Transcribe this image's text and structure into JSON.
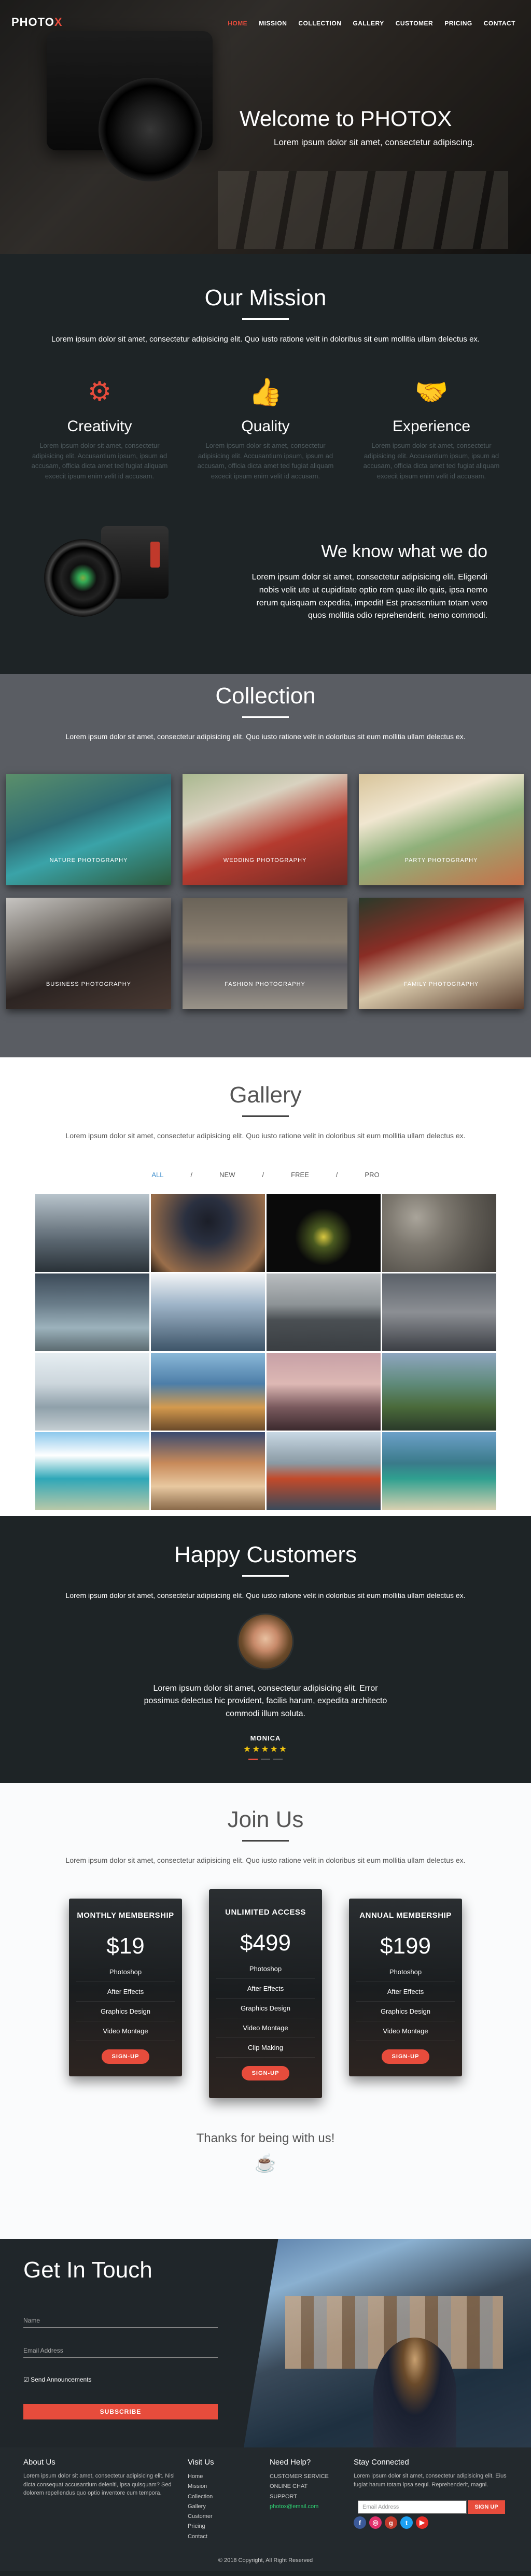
{
  "brand": {
    "logo_text": "PHOTO",
    "logo_x": "X",
    "accent": "#e74c3c"
  },
  "nav": [
    "HOME",
    "MISSION",
    "COLLECTION",
    "GALLERY",
    "CUSTOMER",
    "PRICING",
    "CONTACT"
  ],
  "hero": {
    "title": "Welcome to PHOTO",
    "title_x": "X",
    "subtitle": "Lorem ipsum dolor sit amet, consectetur adipiscing."
  },
  "mission": {
    "title": "Our Mission",
    "lead": "Lorem ipsum dolor sit amet, consectetur adipisicing elit. Quo iusto ratione velit in doloribus sit eum mollitia ullam delectus ex.",
    "features": [
      {
        "icon": "gears-icon",
        "title": "Creativity",
        "text": "Lorem ipsum dolor sit amet, consectetur adipisicing elit. Accusantium ipsum, ipsum ad accusam, officia dicta amet ted fugiat aliquam excecit ipsum enim velit id accusam."
      },
      {
        "icon": "thumbs-up-icon",
        "title": "Quality",
        "text": "Lorem ipsum dolor sit amet, consectetur adipisicing elit. Accusantium ipsum, ipsum ad accusam, officia dicta amet ted fugiat aliquam excecit ipsum enim velit id accusam."
      },
      {
        "icon": "handshake-icon",
        "title": "Experience",
        "text": "Lorem ipsum dolor sit amet, consectetur adipisicing elit. Accusantium ipsum, ipsum ad accusam, officia dicta amet ted fugiat aliquam excecit ipsum enim velit id accusam."
      }
    ],
    "know_title": "We know what we do",
    "know_text": "Lorem ipsum dolor sit amet, consectetur adipisicing elit. Eligendi nobis velit ute ut cupiditate optio rem quae illo quis, ipsa nemo rerum quisquam expedita, impedit! Est praesentium totam vero quos mollitia odio reprehenderit, nemo commodi."
  },
  "collection": {
    "title": "Collection",
    "lead": "Lorem ipsum dolor sit amet, consectetur adipisicing elit. Quo iusto ratione velit in doloribus sit eum mollitia ullam delectus ex.",
    "items": [
      "NATURE PHOTOGRAPHY",
      "WEDDING PHOTOGRAPHY",
      "PARTY PHOTOGRAPHY",
      "BUSINESS PHOTOGRAPHY",
      "FASHION PHOTOGRAPHY",
      "FAMILY PHOTOGRAPHY"
    ]
  },
  "gallery": {
    "title": "Gallery",
    "lead": "Lorem ipsum dolor sit amet, consectetur adipisicing elit. Quo iusto ratione velit in doloribus sit eum mollitia ullam delectus ex.",
    "filters": [
      "ALL",
      "/",
      "NEW",
      "/",
      "FREE",
      "/",
      "PRO"
    ]
  },
  "customers": {
    "title": "Happy Customers",
    "lead": "Lorem ipsum dolor sit amet, consectetur adipisicing elit. Quo iusto ratione velit in doloribus sit eum mollitia ullam delectus ex.",
    "quote": "Lorem ipsum dolor sit amet, consectetur adipisicing elit. Error possimus delectus hic provident, facilis harum, expedita architecto commodi illum soluta.",
    "name": "MONICA",
    "stars": "★★★★★"
  },
  "join": {
    "title": "Join Us",
    "lead": "Lorem ipsum dolor sit amet, consectetur adipisicing elit. Quo iusto ratione velit in doloribus sit eum mollitia ullam delectus ex.",
    "plans": [
      {
        "name": "MONTHLY MEMBERSHIP",
        "price": "$19",
        "features": [
          "Photoshop",
          "After Effects",
          "Graphics Design",
          "Video Montage"
        ],
        "cta": "SIGN-UP"
      },
      {
        "name": "UNLIMITED ACCESS",
        "price": "$499",
        "features": [
          "Photoshop",
          "After Effects",
          "Graphics Design",
          "Video Montage",
          "Clip Making"
        ],
        "cta": "SIGN-UP"
      },
      {
        "name": "ANNUAL MEMBERSHIP",
        "price": "$199",
        "features": [
          "Photoshop",
          "After Effects",
          "Graphics Design",
          "Video Montage"
        ],
        "cta": "SIGN-UP"
      }
    ],
    "thanks": "Thanks for being with us!"
  },
  "contact": {
    "title": "Get In Touch",
    "name_placeholder": "Name",
    "email_placeholder": "Email Address",
    "checkbox_label": "Send Announcements",
    "subscribe": "SUBSCRIBE"
  },
  "footer": {
    "about_title": "About Us",
    "about_text": "Lorem ipsum dolor sit amet, consectetur adipisicing elit. Nisi dicta consequat accusantium deleniti, ipsa quisquam? Sed dolorem repellendus quo optio inventore cum tempora.",
    "visit_title": "Visit Us",
    "visit_links": [
      "Home",
      "Mission",
      "Collection",
      "Gallery",
      "Customer",
      "Pricing",
      "Contact"
    ],
    "help_title": "Need Help?",
    "help_items": [
      "CUSTOMER SERVICE",
      "ONLINE CHAT",
      "SUPPORT"
    ],
    "help_email": "photox@email.com",
    "stay_title": "Stay Connected",
    "stay_text": "Lorem ipsum dolor sit amet, consectetur adipisicing elit. Eius fugiat harum totam ipsa sequi. Reprehenderit, magni.",
    "stay_placeholder": "Email Address",
    "stay_button": "SIGN UP",
    "copyright": "© 2018 Copyright, All Right Reserved"
  }
}
